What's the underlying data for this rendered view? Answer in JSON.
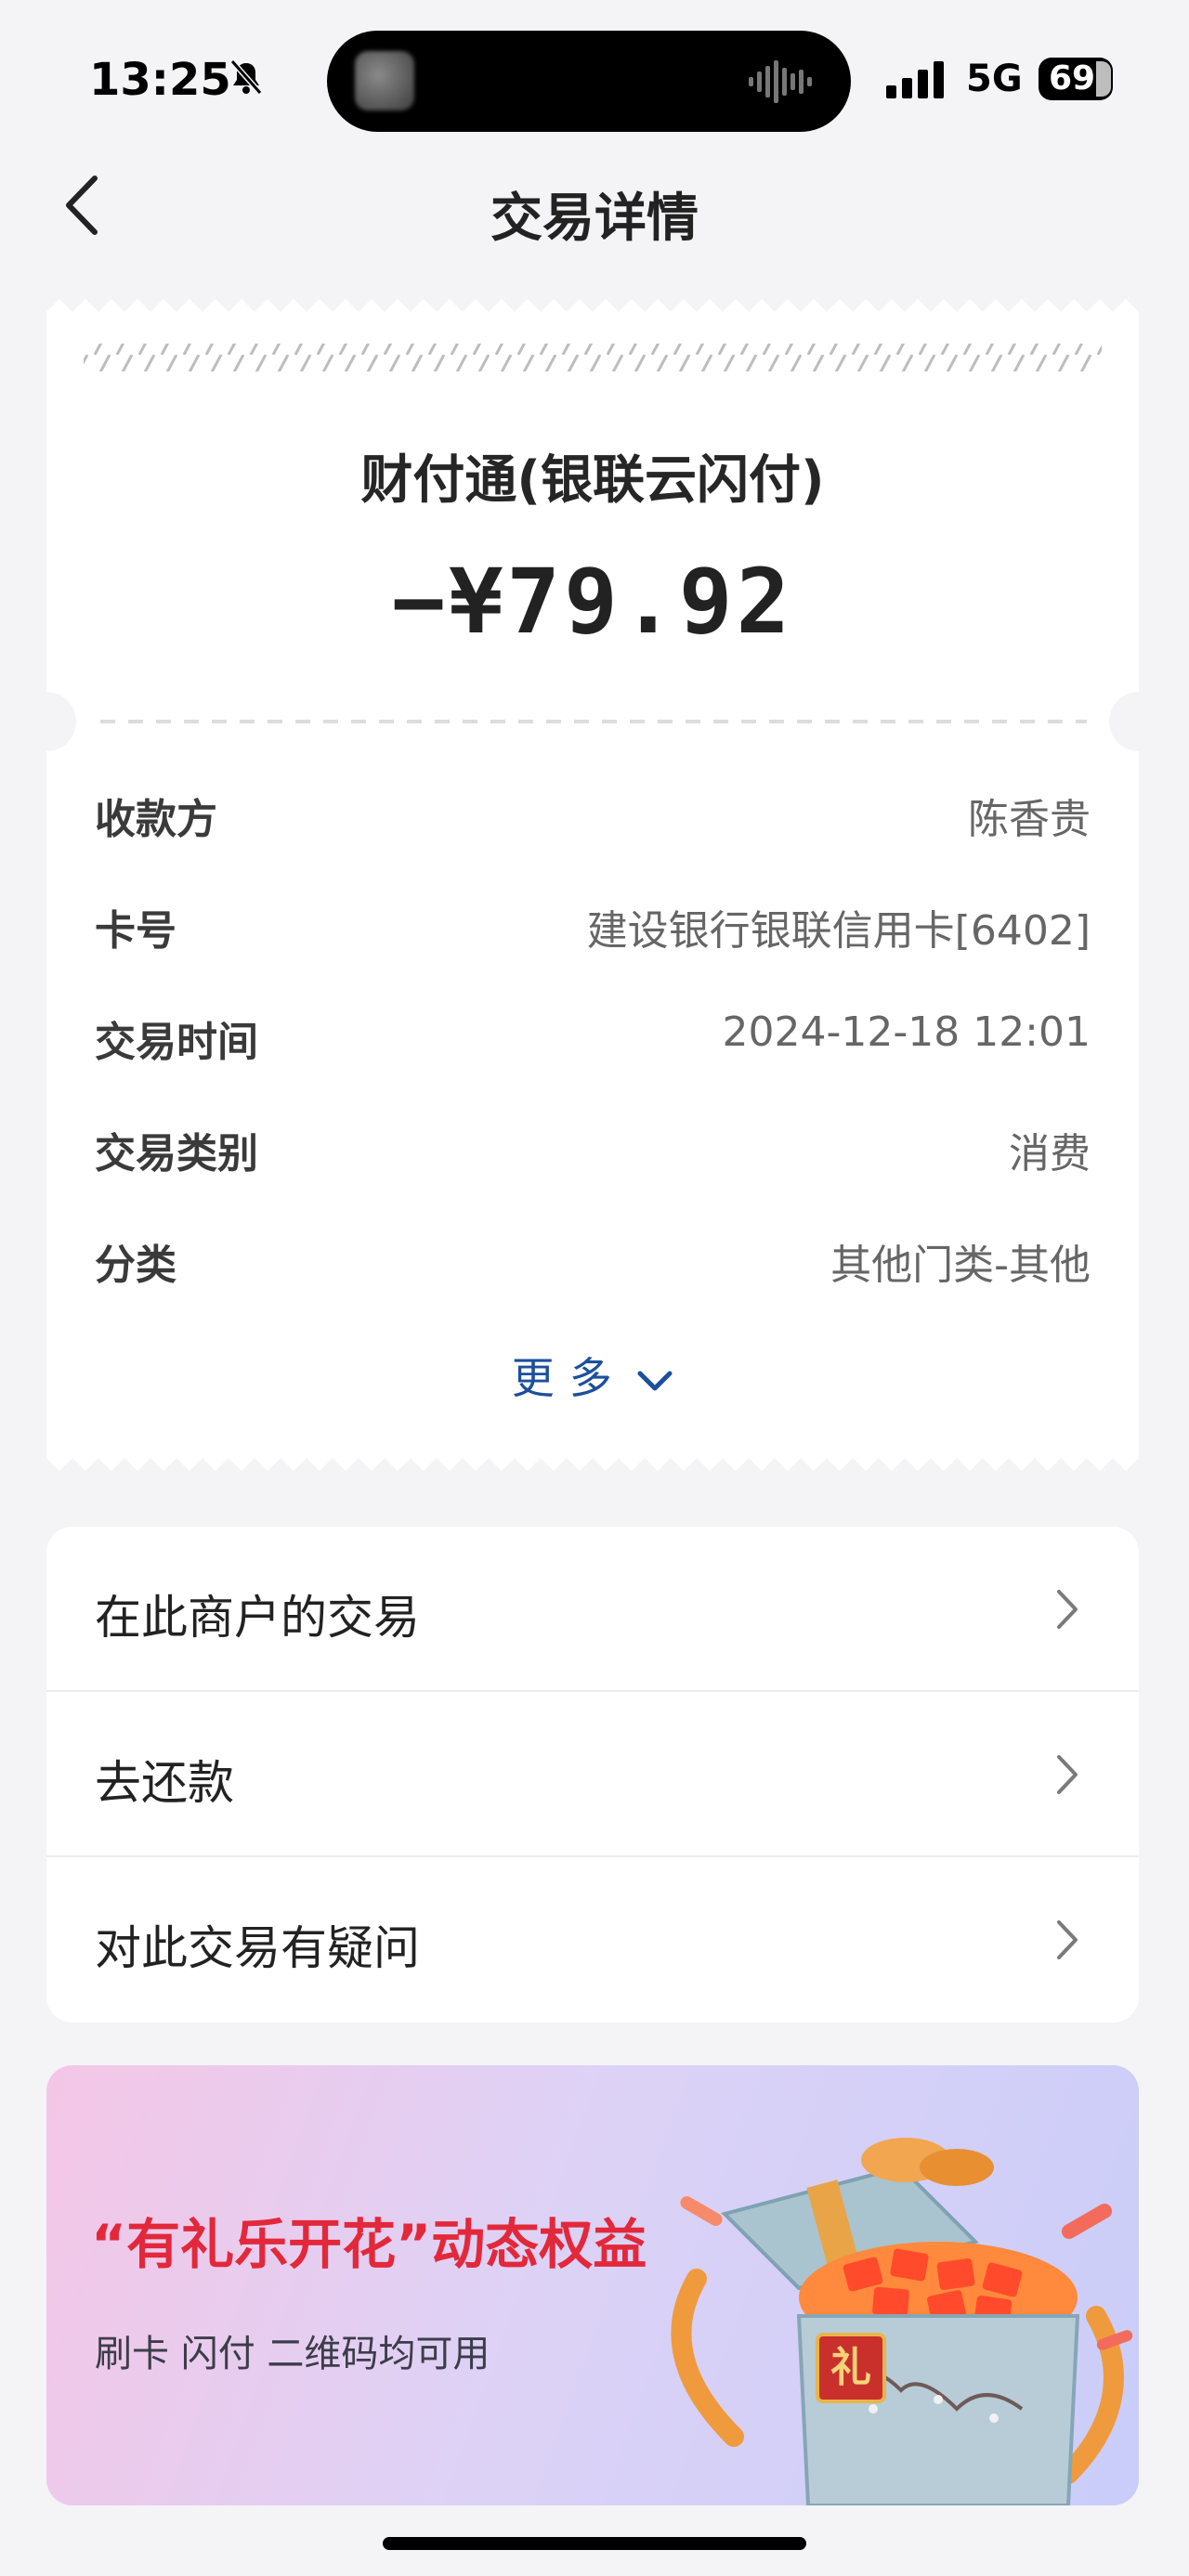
{
  "status_bar": {
    "time": "13:25",
    "network": "5G",
    "battery": "69",
    "battery_level": 0.69
  },
  "nav": {
    "title": "交易详情"
  },
  "receipt": {
    "merchant": "财付通(银联云闪付)",
    "amount": "−¥79.92",
    "details": [
      {
        "label": "收款方",
        "value": "陈香贵"
      },
      {
        "label": "卡号",
        "value": "建设银行银联信用卡[6402]"
      },
      {
        "label": "交易时间",
        "value": "2024-12-18 12:01"
      },
      {
        "label": "交易类别",
        "value": "消费"
      },
      {
        "label": "分类",
        "value": "其他门类-其他"
      }
    ],
    "more_label": "更多"
  },
  "actions": [
    {
      "label": "在此商户的交易"
    },
    {
      "label": "去还款"
    },
    {
      "label": "对此交易有疑问"
    }
  ],
  "banner": {
    "title": "“有礼乐开花”动态权益",
    "subtitle": "刷卡 闪付 二维码均可用",
    "gift_text": "礼"
  },
  "colors": {
    "accent_blue": "#1d4f9b",
    "banner_red": "#e2283a",
    "background": "#f4f4f6"
  }
}
